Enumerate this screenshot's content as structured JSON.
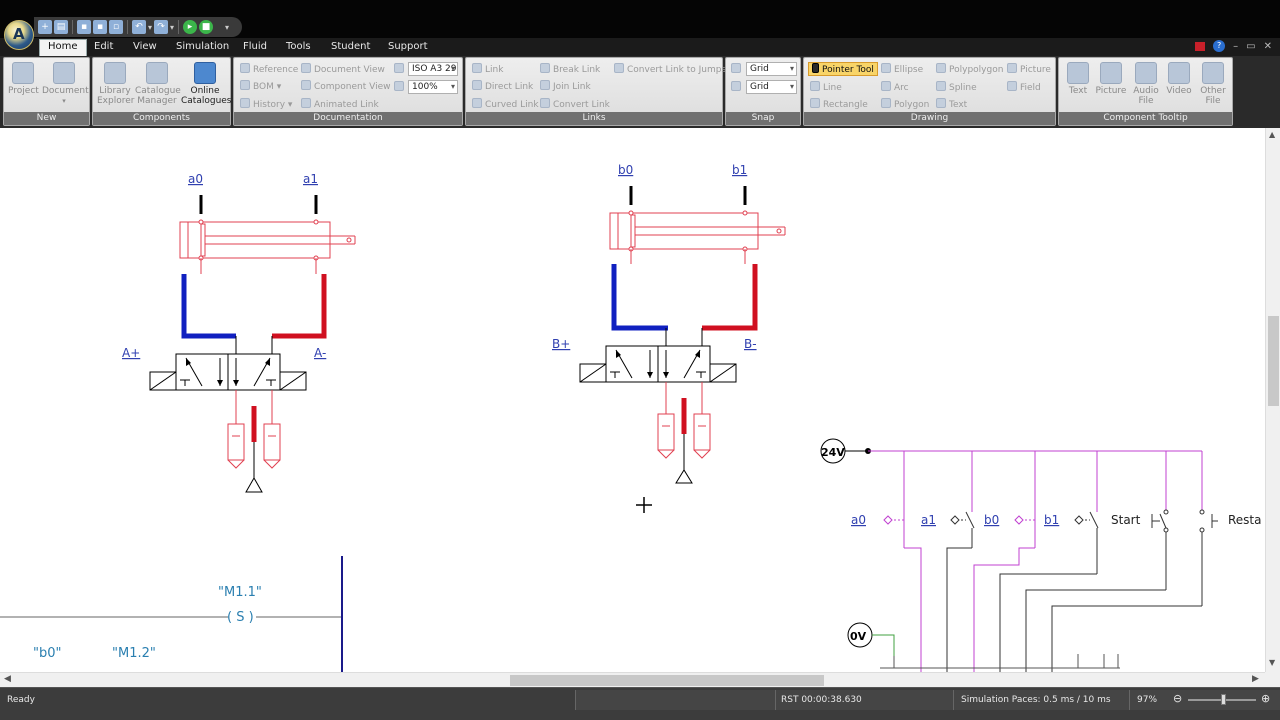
{
  "ribbon_tabs": [
    "Home",
    "Edit",
    "View",
    "Simulation",
    "Fluid",
    "Tools",
    "Student",
    "Support"
  ],
  "groups": {
    "new": {
      "title": "New",
      "project": "Project",
      "document": "Document"
    },
    "components": {
      "title": "Components",
      "library_1": "Library",
      "library_2": "Explorer",
      "catalogue_1": "Catalogue",
      "catalogue_2": "Manager",
      "online_1": "Online",
      "online_2": "Catalogues"
    },
    "documentation": {
      "title": "Documentation",
      "reference": "Reference",
      "bom": "BOM",
      "history": "History",
      "document_view": "Document View",
      "component_view": "Component View",
      "animated_link": "Animated Link",
      "paper_size": "ISO A3 29",
      "zoom": "100%"
    },
    "links": {
      "title": "Links",
      "link": "Link",
      "direct_link": "Direct Link",
      "curved_link": "Curved Link",
      "break_link": "Break Link",
      "join_link": "Join Link",
      "convert_link": "Convert Link",
      "convert_jumps": "Convert Link to Jumps"
    },
    "snap": {
      "title": "Snap",
      "grid_1": "Grid",
      "grid_2": "Grid"
    },
    "drawing": {
      "title": "Drawing",
      "pointer": "Pointer Tool",
      "line": "Line",
      "rectangle": "Rectangle",
      "ellipse": "Ellipse",
      "arc": "Arc",
      "polygon": "Polygon",
      "polypolygon": "Polypolygon",
      "spline": "Spline",
      "text": "Text",
      "picture": "Picture",
      "field": "Field"
    },
    "tooltip": {
      "title": "Component Tooltip",
      "text": "Text",
      "picture": "Picture",
      "audio_1": "Audio",
      "audio_2": "File",
      "video": "Video",
      "other_1": "Other",
      "other_2": "File"
    }
  },
  "circuit": {
    "cyl_a": {
      "left": "a0",
      "right": "a1"
    },
    "cyl_b": {
      "left": "b0",
      "right": "b1"
    },
    "valve_a": {
      "left": "A+",
      "right": "A-"
    },
    "valve_b": {
      "left": "B+",
      "right": "B-"
    },
    "supply": "24V",
    "ground": "0V",
    "contacts": [
      "a0",
      "a1",
      "b0",
      "b1"
    ],
    "start": "Start",
    "restart": "Resta",
    "ladder": {
      "coil_label": "\"M1.1\"",
      "coil": "( S )",
      "contact_1": "\"b0\"",
      "contact_2": "\"M1.2\""
    }
  },
  "status": {
    "ready": "Ready",
    "rst": "RST 00:00:38.630",
    "paces": "Simulation Paces: 0.5 ms / 10 ms",
    "zoom": "97%"
  },
  "colors": {
    "extend": "#1020c0",
    "retract": "#d01020",
    "pneumatic": "#e04050",
    "electric": "#c040d0",
    "link_text": "#3040b0"
  }
}
